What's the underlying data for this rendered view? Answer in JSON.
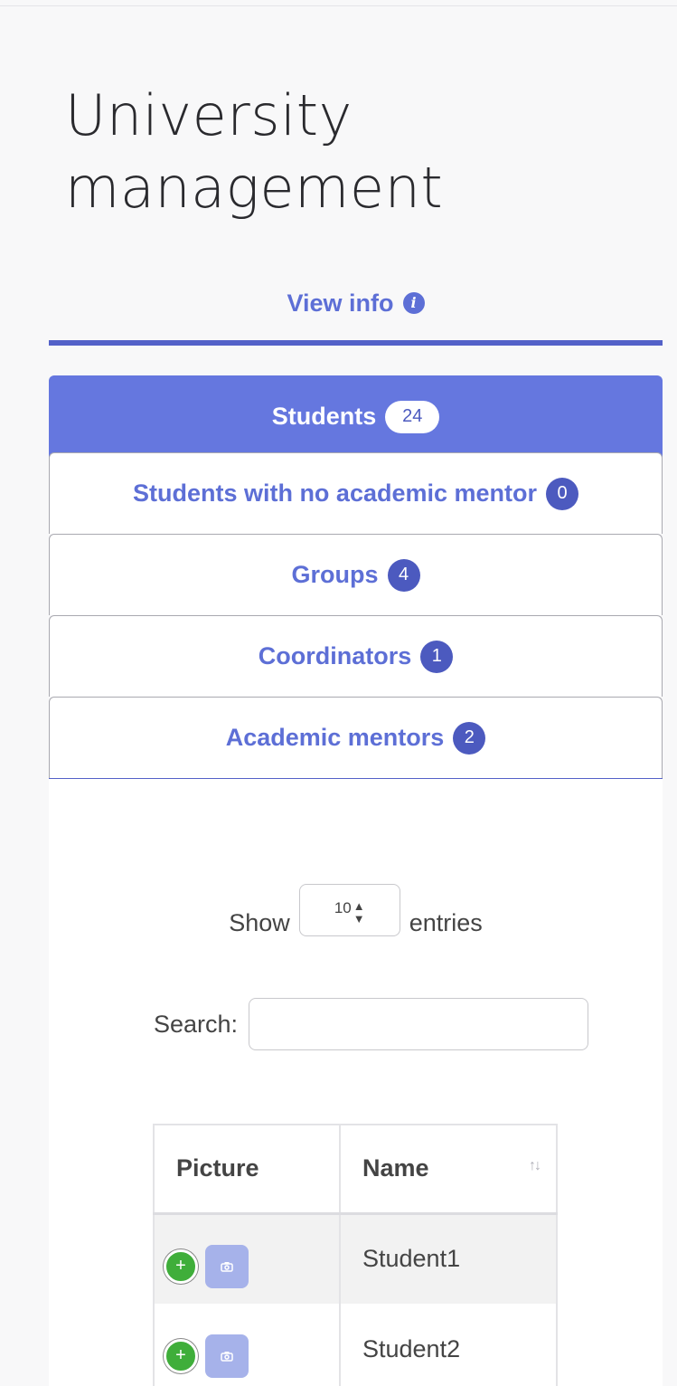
{
  "page": {
    "title": "University management",
    "view_info_label": "View info"
  },
  "tabs": [
    {
      "label": "Students",
      "count": "24",
      "active": true
    },
    {
      "label": "Students with no academic mentor",
      "count": "0",
      "active": false
    },
    {
      "label": "Groups",
      "count": "4",
      "active": false
    },
    {
      "label": "Coordinators",
      "count": "1",
      "active": false
    },
    {
      "label": "Academic mentors",
      "count": "2",
      "active": false
    }
  ],
  "table_controls": {
    "show_label": "Show",
    "entries_value": "10",
    "entries_label": "entries",
    "search_label": "Search:",
    "search_value": ""
  },
  "table": {
    "headers": [
      "Picture",
      "Name"
    ],
    "rows": [
      {
        "name": "Student1"
      },
      {
        "name": "Student2"
      }
    ]
  },
  "colors": {
    "accent": "#5d6fd6",
    "active_tab": "#6577df",
    "badge": "#4c5abf",
    "add_button": "#3fae3a"
  },
  "icons": {
    "view_info": "info-icon",
    "add": "plus-icon",
    "picture": "camera-icon",
    "sort": "sort-icon"
  }
}
